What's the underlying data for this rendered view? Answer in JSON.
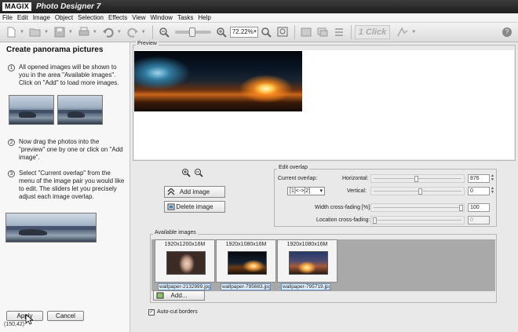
{
  "app": {
    "logo": "MAGIX",
    "title": "Photo Designer 7"
  },
  "menu": [
    "File",
    "Edit",
    "Image",
    "Object",
    "Selection",
    "Effects",
    "View",
    "Window",
    "Tasks",
    "Help"
  ],
  "toolbar": {
    "zoom_value": "72.22%",
    "oneclick_label": "1 Click",
    "zoom_level_fraction": 0.45
  },
  "panel": {
    "title": "Create panorama pictures",
    "steps": [
      {
        "num": "1",
        "text": "All opened images will be shown to you in the area \"Available images\". Click on \"Add\" to load more images."
      },
      {
        "num": "2",
        "text": "Now drag the photos into the \"preview\" one by one or click on \"Add image\"."
      },
      {
        "num": "3",
        "text": "Select \"Current overlap\" from the menu of the image pair you would like to edit. The sliders let you precisely adjust each image overlap."
      }
    ],
    "apply_label": "Apply",
    "cancel_label": "Cancel",
    "coords": "(150,42)"
  },
  "preview": {
    "label": "Preview"
  },
  "middle": {
    "add_image_label": "Add image",
    "delete_image_label": "Delete image"
  },
  "overlap": {
    "group_label": "Edit overlap",
    "current_overlap_label": "Current overlap:",
    "current_overlap_value": "[1]<->[2]",
    "horizontal_label": "Horizontal:",
    "horizontal_value": "876",
    "vertical_label": "Vertical:",
    "vertical_value": "0",
    "width_label": "Width cross-fading [%]:",
    "width_value": "100",
    "location_label": "Location cross-fading:",
    "location_value": "0"
  },
  "available": {
    "group_label": "Available images",
    "images": [
      {
        "resolution": "1920x1200x16M",
        "filename": "wallpaper-2132999.jpg",
        "icon": "portrait"
      },
      {
        "resolution": "1920x1080x16M",
        "filename": "wallpaper-795683.jpg",
        "icon": "space"
      },
      {
        "resolution": "1920x1080x16M",
        "filename": "wallpaper-795719.jpg",
        "icon": "sunset"
      }
    ],
    "add_label": "Add...",
    "autocut_label": "Auto-cut borders",
    "autocut_checked": true
  }
}
